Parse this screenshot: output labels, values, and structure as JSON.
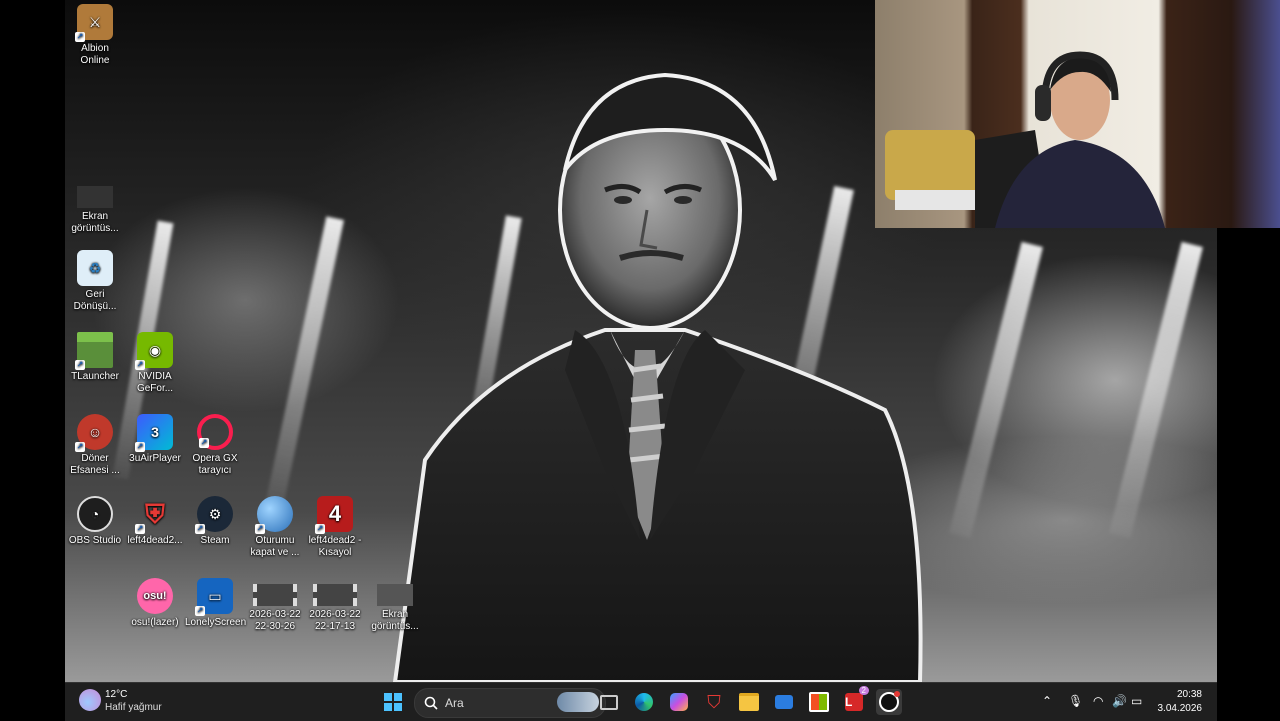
{
  "desktop": {
    "icons": [
      {
        "label": "Albion\nOnline",
        "icon": "albion-icon",
        "color": "#b07a3a"
      },
      {
        "label": "Ekran\ngörüntüs...",
        "icon": "screenshot-thumb-icon",
        "color": "#333333"
      },
      {
        "label": "Geri\nDönüşü...",
        "icon": "recycle-bin-icon",
        "color": "#dfeef8"
      },
      {
        "label": "TLauncher",
        "icon": "minecraft-block-icon",
        "color": "#5a8f3a"
      },
      {
        "label": "NVIDIA\nGeFor...",
        "icon": "nvidia-icon",
        "color": "#76b900"
      },
      {
        "label": "Döner\nEfsanesi ...",
        "icon": "doner-game-icon",
        "color": "#c0392b"
      },
      {
        "label": "3uAirPlayer",
        "icon": "3uairplayer-icon",
        "color": "#3d5afe"
      },
      {
        "label": "Opera GX\ntarayıcı",
        "icon": "opera-gx-icon",
        "color": "#fa1e4e"
      },
      {
        "label": "OBS Studio",
        "icon": "obs-icon",
        "color": "#1e1e1e"
      },
      {
        "label": "left4dead2...",
        "icon": "shield-icon",
        "color": "#c62828"
      },
      {
        "label": "Steam",
        "icon": "steam-icon",
        "color": "#1b2838"
      },
      {
        "label": "Oturumu\nkapat ve ...",
        "icon": "globe-icon",
        "color": "#3a8fd8"
      },
      {
        "label": "left4dead2 -\nKısayol",
        "icon": "l4d2-icon",
        "color": "#b71c1c"
      },
      {
        "label": "osu!(lazer)",
        "icon": "osu-icon",
        "color": "#ff66aa"
      },
      {
        "label": "LonelyScreen",
        "icon": "monitor-icon",
        "color": "#1565c0"
      },
      {
        "label": "2026-03-22\n22-30-26",
        "icon": "video-thumb-icon",
        "color": "#444444"
      },
      {
        "label": "2026-03-22\n22-17-13",
        "icon": "video-thumb-icon",
        "color": "#444444"
      },
      {
        "label": "Ekran\ngörüntüs...",
        "icon": "screenshot-thumb-icon",
        "color": "#555555"
      }
    ]
  },
  "taskbar": {
    "weather_temp": "12°C",
    "weather_desc": "Hafif yağmur",
    "search_placeholder": "Ara",
    "clock_time": "20:38",
    "clock_date": "3.04.2026",
    "pinned": [
      {
        "name": "start-button",
        "icon": "windows-logo-icon"
      },
      {
        "name": "widgets-button",
        "icon": "widgets-icon"
      },
      {
        "name": "task-view-button",
        "icon": "task-view-icon"
      },
      {
        "name": "edge-button",
        "icon": "edge-icon"
      },
      {
        "name": "copilot-button",
        "icon": "copilot-icon"
      },
      {
        "name": "mcafee-button",
        "icon": "mcafee-icon"
      },
      {
        "name": "file-explorer-button",
        "icon": "folder-icon"
      },
      {
        "name": "mail-button",
        "icon": "mail-icon"
      },
      {
        "name": "store-button",
        "icon": "store-icon"
      },
      {
        "name": "app-l-button",
        "icon": "l-app-icon"
      },
      {
        "name": "obs-taskbar-button",
        "icon": "obs-icon"
      }
    ],
    "notification_badge": "2"
  }
}
